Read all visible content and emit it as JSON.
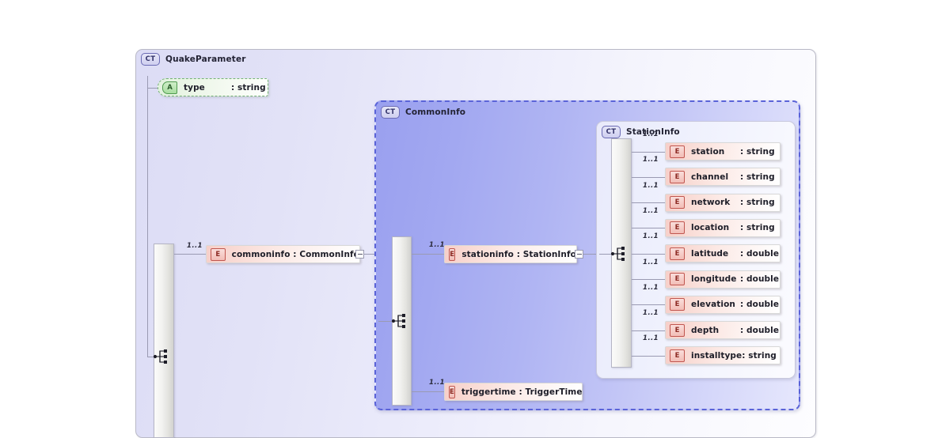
{
  "diagram": {
    "kind": "xml-schema-diagram",
    "colors": {
      "element_accent": "#f2bdb6",
      "attribute_accent": "#a8dda0",
      "container_accent": "#9aa0ef",
      "connector": "#9a9ab2"
    }
  },
  "root": {
    "badge": "CT",
    "title": "QuakeParameter",
    "attribute": {
      "badge": "A",
      "name": "type",
      "type": ": string"
    },
    "child": {
      "badge": "E",
      "name": "commoninfo : CommonInfo",
      "cardinality": "1..1",
      "toggle": "−"
    }
  },
  "common_info": {
    "badge": "CT",
    "title": "CommonInfo",
    "children": [
      {
        "badge": "E",
        "name": "stationinfo : StationInfo",
        "cardinality": "1..1",
        "toggle": "−"
      },
      {
        "badge": "E",
        "name": "triggertime : TriggerTime",
        "cardinality": "1..1"
      }
    ]
  },
  "station_info": {
    "badge": "CT",
    "title": "StationInfo",
    "elements": [
      {
        "badge": "E",
        "name": "station",
        "type": ": string",
        "cardinality": "1..1"
      },
      {
        "badge": "E",
        "name": "channel",
        "type": ": string",
        "cardinality": "1..1"
      },
      {
        "badge": "E",
        "name": "network",
        "type": ": string",
        "cardinality": "1..1"
      },
      {
        "badge": "E",
        "name": "location",
        "type": ": string",
        "cardinality": "1..1"
      },
      {
        "badge": "E",
        "name": "latitude",
        "type": ": double",
        "cardinality": "1..1"
      },
      {
        "badge": "E",
        "name": "longitude",
        "type": ": double",
        "cardinality": "1..1"
      },
      {
        "badge": "E",
        "name": "elevation",
        "type": ": double",
        "cardinality": "1..1"
      },
      {
        "badge": "E",
        "name": "depth",
        "type": ": double",
        "cardinality": "1..1"
      },
      {
        "badge": "E",
        "name": "installtype",
        "type": ": string",
        "cardinality": "1..1"
      }
    ]
  }
}
